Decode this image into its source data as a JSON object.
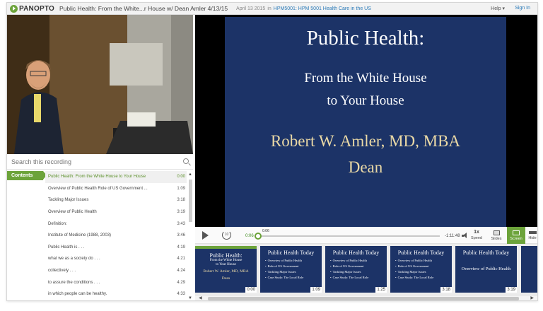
{
  "header": {
    "logo_text": "PANOPTO",
    "recording_title": "Public Health: From the White...r House w/ Dean Amler 4/13/15",
    "date": "April 13 2015",
    "in_label": "in",
    "folder": "HPM5001: HPM 5001 Health Care in the US",
    "help_label": "Help ▾",
    "signin_label": "Sign In"
  },
  "search": {
    "placeholder": "Search this recording"
  },
  "contents": {
    "tab_label": "Contents",
    "items": [
      {
        "title": "Public Health: From the White House to Your House",
        "time": "0:00"
      },
      {
        "title": "Overview of Public Health Role of US Government ...",
        "time": "1:09"
      },
      {
        "title": "Tackling Major Issues",
        "time": "3:18"
      },
      {
        "title": "Overview of Public Health",
        "time": "3:19"
      },
      {
        "title": "Definition:",
        "time": "3:43"
      },
      {
        "title": "Institute of Medicine (1988, 2003)",
        "time": "3:46"
      },
      {
        "title": "Public Health is . . .",
        "time": "4:19"
      },
      {
        "title": "what we as a society do . . .",
        "time": "4:21"
      },
      {
        "title": "collectively . . .",
        "time": "4:24"
      },
      {
        "title": "to assure the conditions . . .",
        "time": "4:29"
      },
      {
        "title": "in which people can be healthy.",
        "time": "4:33"
      }
    ]
  },
  "slide": {
    "title": "Public Health:",
    "subtitle_line1": "From the White House",
    "subtitle_line2": "to Your House",
    "author": "Robert W. Amler, MD, MBA",
    "role": "Dean"
  },
  "controls": {
    "current_time": "0:06",
    "progress_label": "0:06",
    "remaining_time": "-1:11:48",
    "progress_fraction": 0.0014,
    "speed_value": "1x",
    "speed_label": "Speed",
    "slides_label": "Slides",
    "screen_label": "Screen",
    "hide_label": "Hide",
    "rewind_label": "10"
  },
  "filmstrip": [
    {
      "title": "Public Health:",
      "sub1": "From the White House",
      "sub2": "to Your House",
      "author": "Robert W. Amler, MD, MBA",
      "role": "Dean",
      "time": "0:00"
    },
    {
      "title": "Public Health Today",
      "bullets": [
        "Overview of Public Health",
        "Role of US Government",
        "Tackling Major Issues",
        "Case Study: The Local Role"
      ],
      "time": "1:09"
    },
    {
      "title": "Public Health Today",
      "bullets": [
        "Overview of Public Health",
        "Role of US Government",
        "Tackling Major Issues",
        "Case Study: The Local Role"
      ],
      "time": "1:25"
    },
    {
      "title": "Public Health Today",
      "bullets": [
        "Overview of Public Health",
        "Role of US Government",
        "Tackling Major Issues",
        "Case Study: The Local Role"
      ],
      "time": "3:18"
    },
    {
      "title": "Public Health Today",
      "note": "Overview of Public Health",
      "time": "3:19"
    }
  ],
  "colors": {
    "accent": "#6ca33a",
    "slide_bg": "#1c3367",
    "slide_gold": "#ead9a6",
    "link": "#2a7ab8"
  }
}
